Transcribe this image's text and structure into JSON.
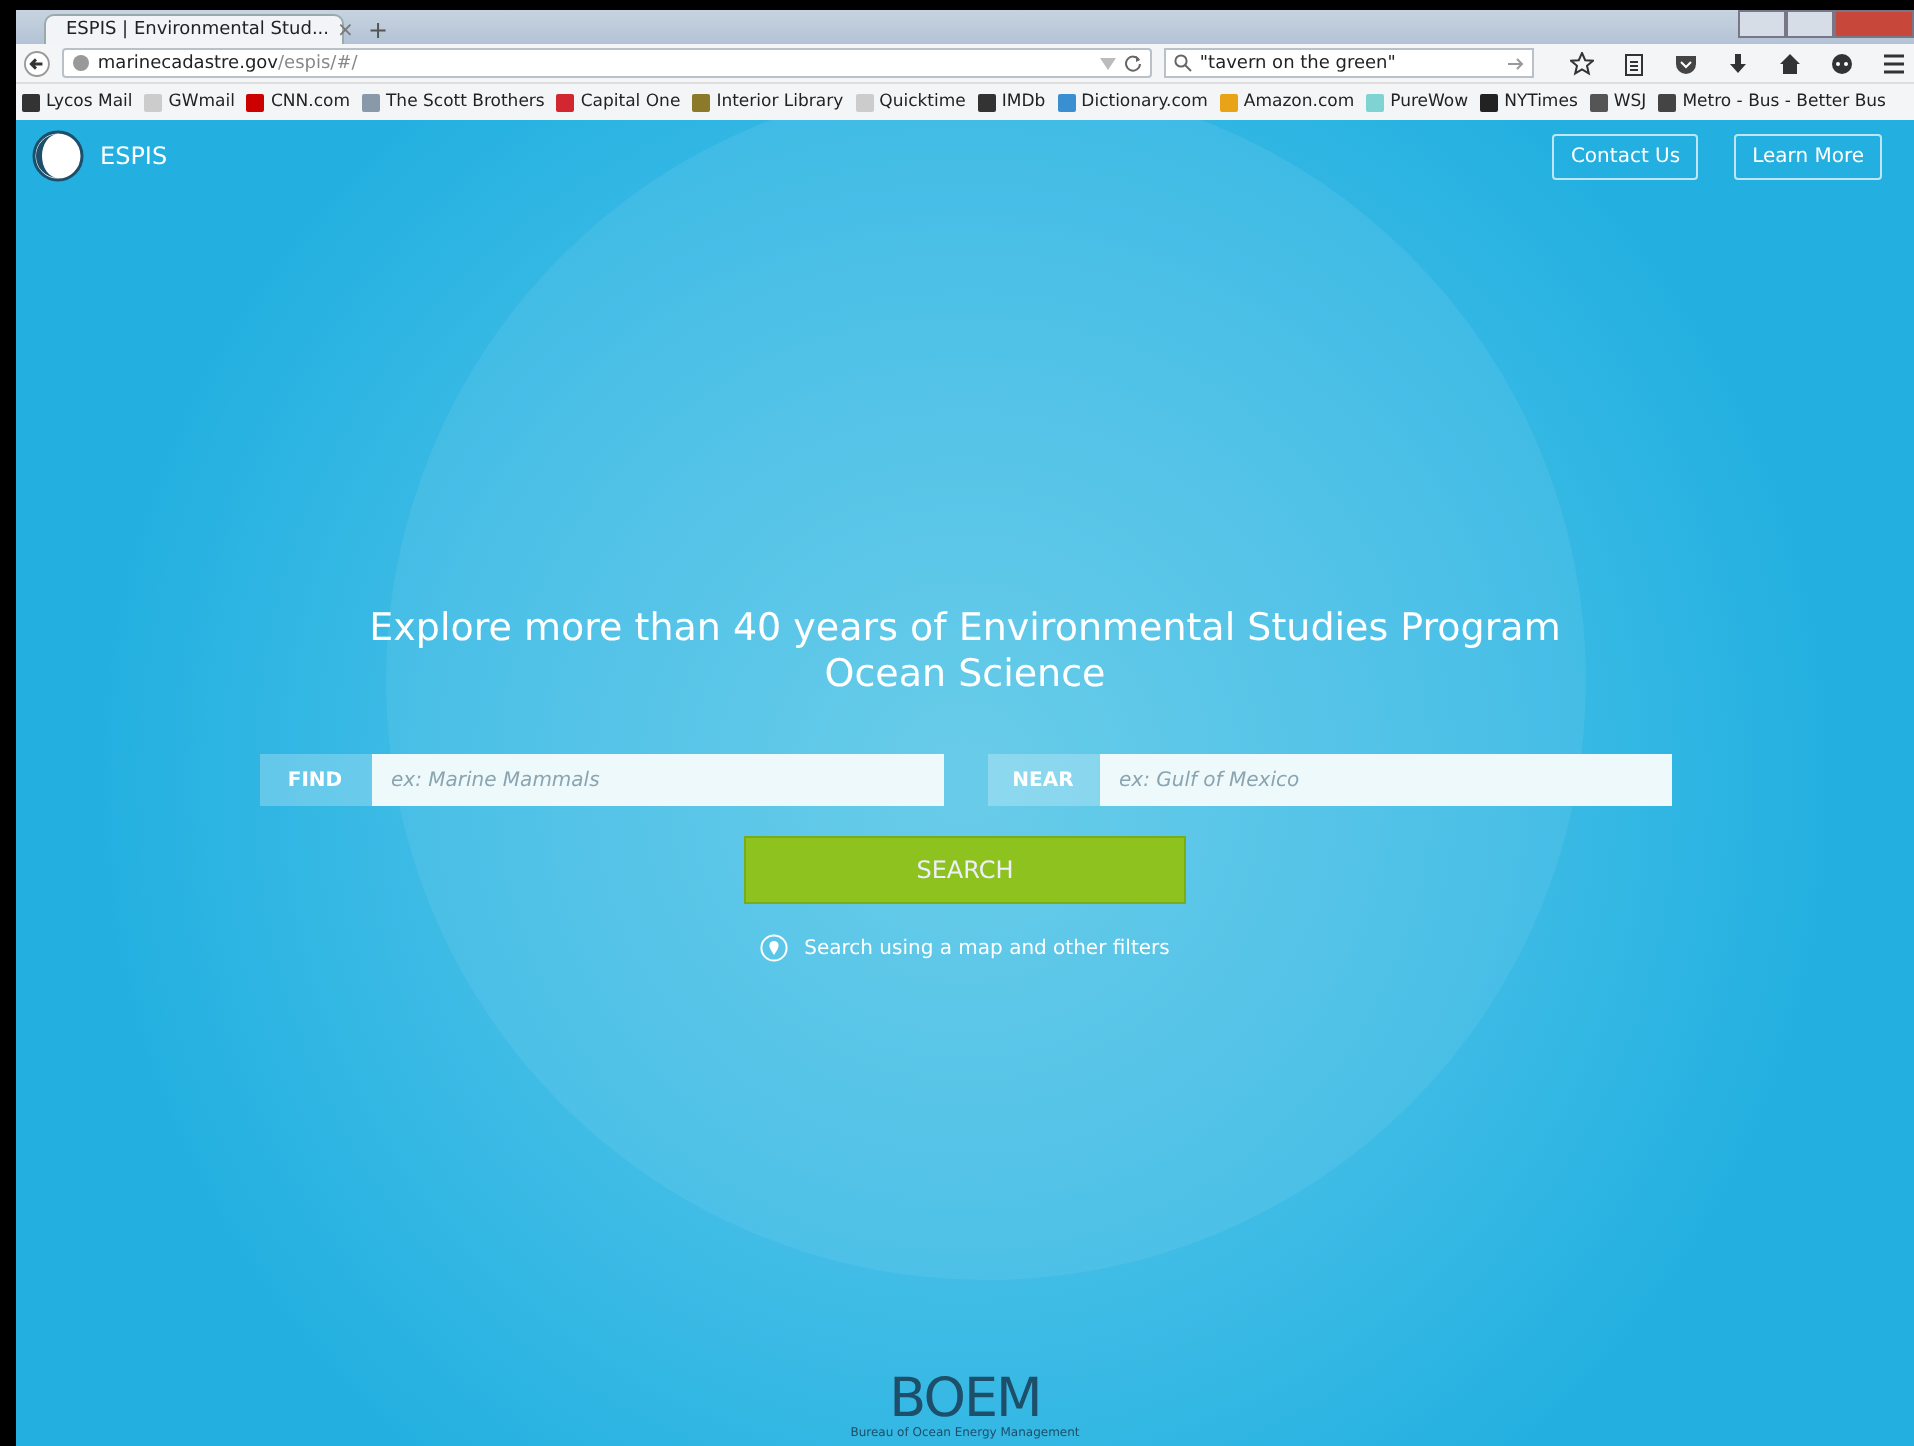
{
  "browser": {
    "tab": {
      "title": "ESPIS | Environmental Stud...",
      "close": "×",
      "new_tab": "+"
    },
    "url": {
      "host": "marinecadastre.gov",
      "path": "/espis/#/"
    },
    "search": {
      "value": "\"tavern on the green\""
    },
    "bookmarks": [
      {
        "label": "Lycos Mail",
        "color": "#333333"
      },
      {
        "label": "GWmail",
        "color": "#cccccc"
      },
      {
        "label": "CNN.com",
        "color": "#cc0000"
      },
      {
        "label": "The Scott Brothers",
        "color": "#8899aa"
      },
      {
        "label": "Capital One",
        "color": "#d22630"
      },
      {
        "label": "Interior Library",
        "color": "#8a7a2a"
      },
      {
        "label": "Quicktime",
        "color": "#cccccc"
      },
      {
        "label": "IMDb",
        "color": "#333333"
      },
      {
        "label": "Dictionary.com",
        "color": "#3a8fd0"
      },
      {
        "label": "Amazon.com",
        "color": "#e8a317"
      },
      {
        "label": "PureWow",
        "color": "#7fd3d3"
      },
      {
        "label": "NYTimes",
        "color": "#222222"
      },
      {
        "label": "WSJ",
        "color": "#555555"
      },
      {
        "label": "Metro - Bus - Better Bus",
        "color": "#444444"
      }
    ]
  },
  "page": {
    "logo": "ESPIS",
    "nav": [
      "Contact Us",
      "Learn More"
    ],
    "headline": "Explore more than 40 years of Environmental Studies Program Ocean Science",
    "find": {
      "label": "FIND",
      "placeholder": "ex: Marine Mammals"
    },
    "near": {
      "label": "NEAR",
      "placeholder": "ex: Gulf of Mexico"
    },
    "search_button": "SEARCH",
    "map_link": "Search using a map and other filters",
    "footer_logo": {
      "name": "BOEM",
      "subtitle": "Bureau of Ocean Energy Management"
    }
  }
}
